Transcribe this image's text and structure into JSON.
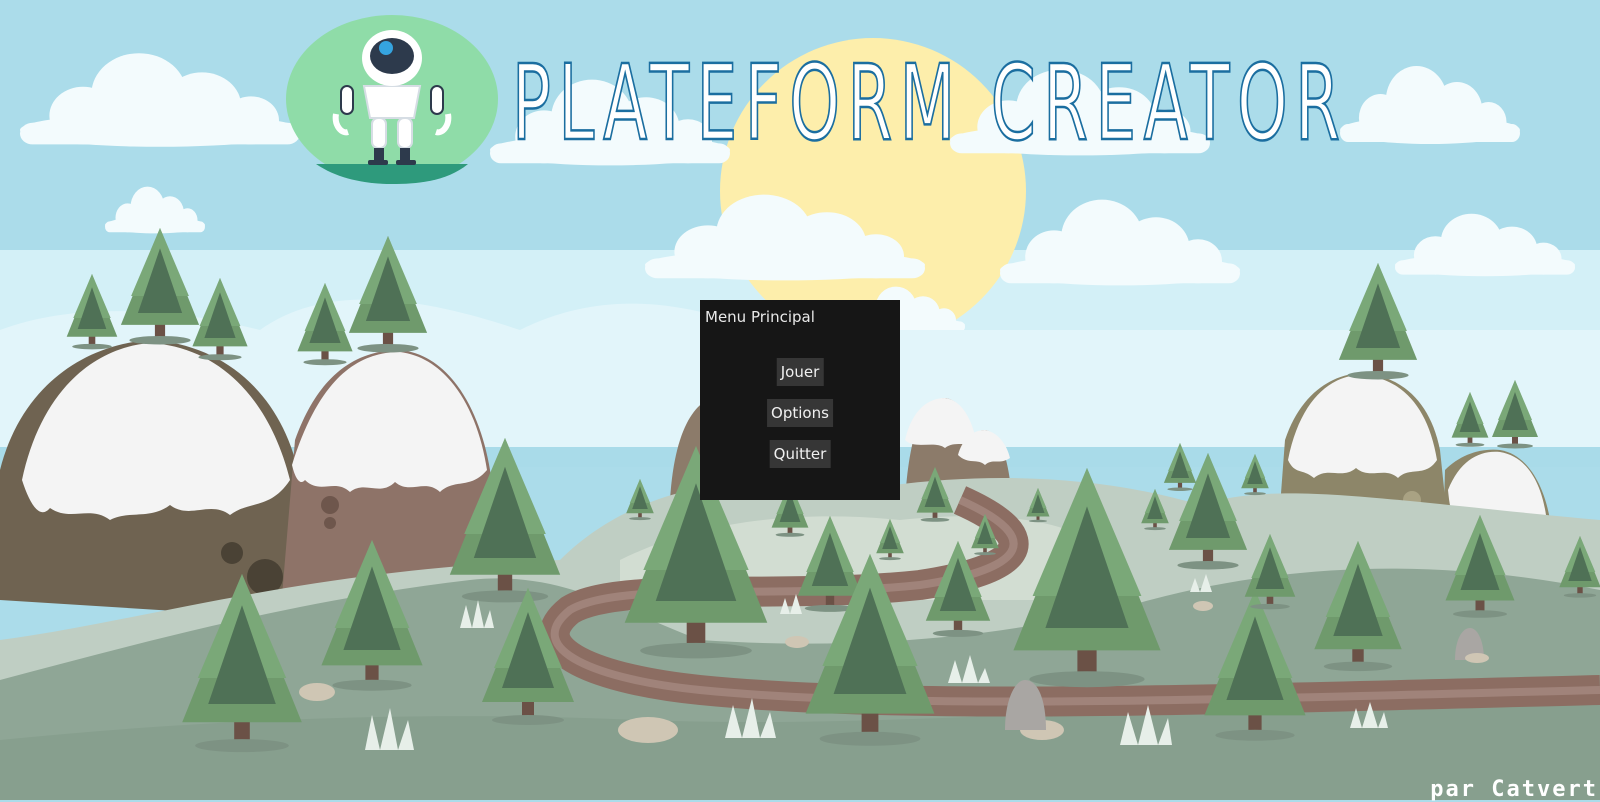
{
  "title": "PLATEFORM CREATOR",
  "menu": {
    "title": "Menu Principal",
    "buttons": {
      "play": "Jouer",
      "options": "Options",
      "quit": "Quitter"
    }
  },
  "credit": "par Catvert",
  "colors": {
    "sky": "#abdcea",
    "title_blue": "#1b6ea0",
    "panel": "#161616",
    "button": "#363636",
    "sun": "#fdeeab",
    "ground": "#8fa696",
    "path": "#8c6d62"
  }
}
